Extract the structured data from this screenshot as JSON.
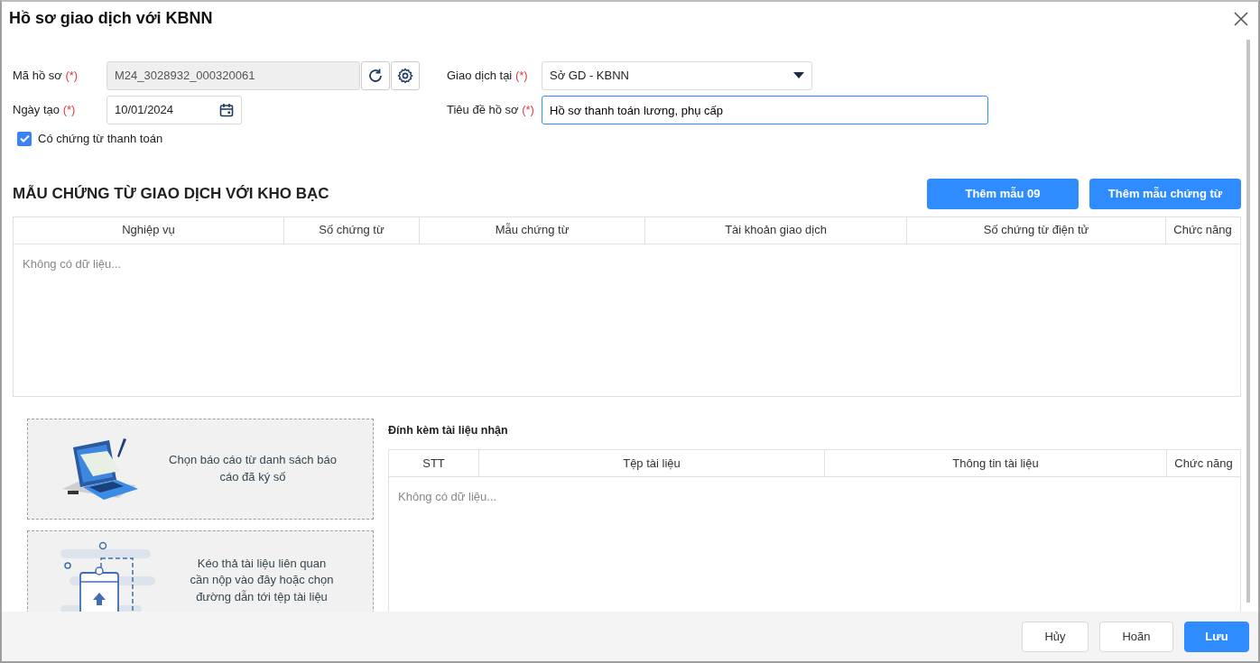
{
  "window": {
    "title": "Hồ sơ giao dịch với KBNN"
  },
  "form": {
    "record_code": {
      "label": "Mã hồ sơ",
      "required": "(*)",
      "value": "M24_3028932_000320061"
    },
    "created_date": {
      "label": "Ngày tạo",
      "required": "(*)",
      "value": "10/01/2024"
    },
    "transaction_at": {
      "label": "Giao dịch tại",
      "required": "(*)",
      "value": "Sở GD - KBNN"
    },
    "record_title": {
      "label": "Tiêu đề hồ sơ",
      "required": "(*)",
      "value": "Hồ sơ thanh toán lương, phụ cấp"
    },
    "has_payment_voucher": {
      "label": "Có chứng từ thanh toán",
      "checked": true
    }
  },
  "voucher_section": {
    "title": "MẪU CHỨNG TỪ GIAO DỊCH VỚI KHO BẠC",
    "buttons": [
      "Thêm mẫu 09",
      "Thêm mẫu chứng từ"
    ],
    "table": {
      "columns": [
        "Nghiệp vụ",
        "Số chứng từ",
        "Mẫu chứng từ",
        "Tài khoản giao dịch",
        "Số chứng từ điện tử",
        "Chức năng"
      ],
      "empty_text": "Không có dữ liệu..."
    }
  },
  "upload_zones": [
    {
      "kind": "signed_report",
      "text": "Chọn báo cáo từ danh sách báo cáo đã ký số"
    },
    {
      "kind": "drag_drop",
      "text": "Kéo thả tài liệu liên quan cần nộp vào đây hoặc chọn đường dẫn tới tệp tài liệu"
    }
  ],
  "attachments": {
    "title": "Đính kèm tài liệu nhận",
    "table": {
      "columns": [
        "STT",
        "Tệp tài liệu",
        "Thông tin tài liệu",
        "Chức năng"
      ],
      "empty_text": "Không có dữ liệu..."
    }
  },
  "footer_buttons": [
    {
      "label": "Hủy",
      "kind": "secondary"
    },
    {
      "label": "Hoãn",
      "kind": "secondary"
    },
    {
      "label": "Lưu",
      "kind": "primary"
    }
  ]
}
